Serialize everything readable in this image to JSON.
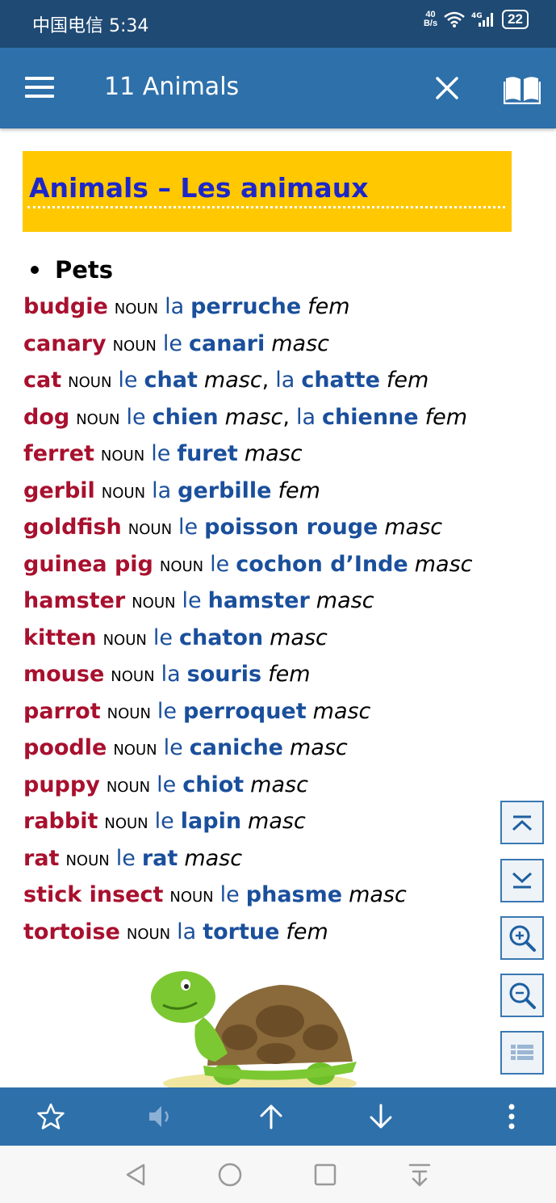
{
  "status": {
    "carrier_time": "中国电信 5:34",
    "net_speed_top": "40",
    "net_speed_unit": "B/s",
    "battery": "22"
  },
  "appbar": {
    "title": "11 Animals"
  },
  "heading": "Animals – Les animaux",
  "section": "Pets",
  "entries": [
    {
      "en": "budgie",
      "pos": "NOUN",
      "forms": [
        {
          "art": "la",
          "fr": "perruche",
          "gender": "fem"
        }
      ]
    },
    {
      "en": "canary",
      "pos": "NOUN",
      "forms": [
        {
          "art": "le",
          "fr": "canari",
          "gender": "masc"
        }
      ]
    },
    {
      "en": "cat",
      "pos": "NOUN",
      "forms": [
        {
          "art": "le",
          "fr": "chat",
          "gender": "masc"
        },
        {
          "art": "la",
          "fr": "chatte",
          "gender": "fem"
        }
      ]
    },
    {
      "en": "dog",
      "pos": "NOUN",
      "forms": [
        {
          "art": "le",
          "fr": "chien",
          "gender": "masc"
        },
        {
          "art": "la",
          "fr": "chienne",
          "gender": "fem"
        }
      ]
    },
    {
      "en": "ferret",
      "pos": "NOUN",
      "forms": [
        {
          "art": "le",
          "fr": "furet",
          "gender": "masc"
        }
      ]
    },
    {
      "en": "gerbil",
      "pos": "NOUN",
      "forms": [
        {
          "art": "la",
          "fr": "gerbille",
          "gender": "fem"
        }
      ]
    },
    {
      "en": "goldfish",
      "pos": "NOUN",
      "forms": [
        {
          "art": "le",
          "fr": "poisson rouge",
          "gender": "masc"
        }
      ]
    },
    {
      "en": "guinea pig",
      "pos": "NOUN",
      "forms": [
        {
          "art": "le",
          "fr": "cochon d’Inde",
          "gender": "masc"
        }
      ]
    },
    {
      "en": "hamster",
      "pos": "NOUN",
      "forms": [
        {
          "art": "le",
          "fr": "hamster",
          "gender": "masc"
        }
      ]
    },
    {
      "en": "kitten",
      "pos": "NOUN",
      "forms": [
        {
          "art": "le",
          "fr": "chaton",
          "gender": "masc"
        }
      ]
    },
    {
      "en": "mouse",
      "pos": "NOUN",
      "forms": [
        {
          "art": "la",
          "fr": "souris",
          "gender": "fem"
        }
      ]
    },
    {
      "en": "parrot",
      "pos": "NOUN",
      "forms": [
        {
          "art": "le",
          "fr": "perroquet",
          "gender": "masc"
        }
      ]
    },
    {
      "en": "poodle",
      "pos": "NOUN",
      "forms": [
        {
          "art": "le",
          "fr": "caniche",
          "gender": "masc"
        }
      ]
    },
    {
      "en": "puppy",
      "pos": "NOUN",
      "forms": [
        {
          "art": "le",
          "fr": "chiot",
          "gender": "masc"
        }
      ]
    },
    {
      "en": "rabbit",
      "pos": "NOUN",
      "forms": [
        {
          "art": "le",
          "fr": "lapin",
          "gender": "masc"
        }
      ]
    },
    {
      "en": "rat",
      "pos": "NOUN",
      "forms": [
        {
          "art": "le",
          "fr": "rat",
          "gender": "masc"
        }
      ]
    },
    {
      "en": "stick insect",
      "pos": "NOUN",
      "forms": [
        {
          "art": "le",
          "fr": "phasme",
          "gender": "masc"
        }
      ]
    },
    {
      "en": "tortoise",
      "pos": "NOUN",
      "forms": [
        {
          "art": "la",
          "fr": "tortue",
          "gender": "fem"
        }
      ]
    }
  ],
  "side_buttons": [
    "scroll-top-icon",
    "scroll-bottom-icon",
    "zoom-in-icon",
    "zoom-out-icon",
    "list-icon"
  ],
  "bottom_bar": [
    "star-icon",
    "speaker-icon",
    "arrow-up-icon",
    "arrow-down-icon",
    "more-icon"
  ],
  "nav_bar": [
    "back-icon",
    "home-icon",
    "recents-icon",
    "notification-icon"
  ],
  "colors": {
    "appbar": "#2e70aa",
    "statusbar": "#1f4a74",
    "heading_bg": "#ffc800",
    "heading_text": "#1d27c9",
    "english": "#a8102e",
    "french": "#1a4f9c"
  }
}
